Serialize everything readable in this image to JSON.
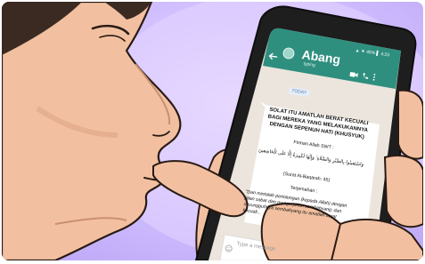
{
  "chat": {
    "contact_name": "Abang",
    "contact_status": "typing",
    "status_bar": "▲ ▼ 45% ▌ 4:23",
    "date_chip": "TODAY",
    "message": {
      "title": "SOLAT ITU AMATLAH BERAT KECUALI BAGI MEREKA YANG MELAKUKANNYA DENGAN SEPENUH HATI (KHUSYUK)",
      "intro": "Firman Allah SWT :",
      "arabic": "وَاسْتَعِينُوا بِالصَّبْرِ وَالصَّلَاةِ ۚ وَإِنَّهَا لَكَبِيرَةٌ إِلَّا عَلَى الْخَاشِعِينَ",
      "reference": "(Surat Al-Baqarah: 45)",
      "translation_label": "Terjemahan :",
      "translation": "\"Dan mintalah pertolongan (kepada Allah) dengan jalan sabar dan mengerjakan sembahyang; dan sesungguhnya sembahyang itu amatlah berat kecuali..."
    },
    "input_placeholder": "Type a message"
  },
  "icons": {
    "back": "back-arrow-icon",
    "video": "video-camera-icon",
    "call": "phone-icon",
    "menu": "more-vertical-icon",
    "emoji": "emoji-icon"
  },
  "colors": {
    "background": "#cbb8ff",
    "header": "#2f8f7f",
    "chat_bg": "#ece5dd",
    "bubble": "#ffffff",
    "skin": "#f2c0a0",
    "phone": "#1e1e1e"
  }
}
